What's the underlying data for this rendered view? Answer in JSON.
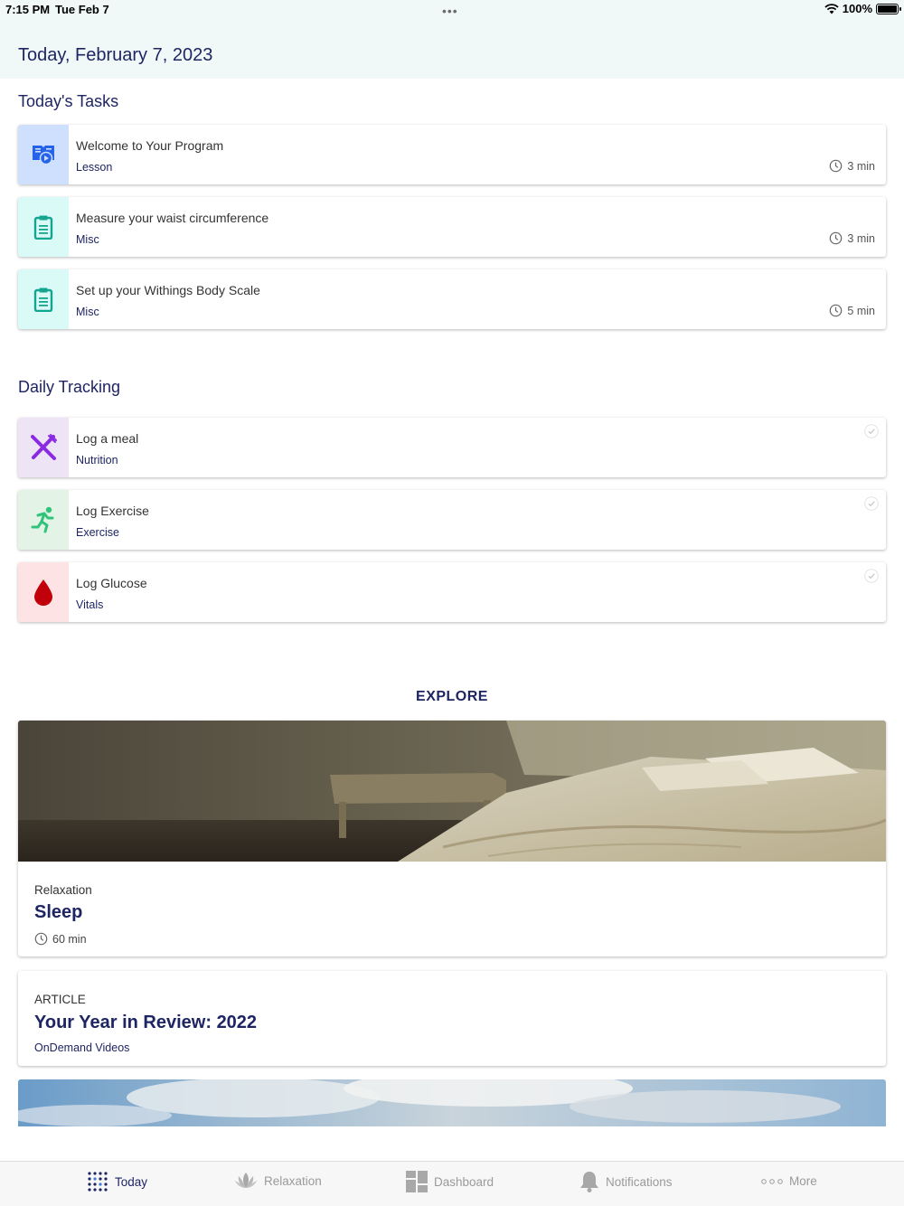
{
  "status_bar": {
    "time": "7:15 PM",
    "date": "Tue Feb 7",
    "dots": "•••",
    "battery": "100%",
    "battery_level": 1.0,
    "icons": [
      "wifi-icon",
      "battery-icon"
    ]
  },
  "header": {
    "date": "Today, February 7, 2023"
  },
  "tasks": {
    "title": "Today's Tasks",
    "items": [
      {
        "title": "Welcome to Your Program",
        "type": "Lesson",
        "duration": "3 min",
        "icon": "lesson-icon",
        "tile_color": "#cfe0ff",
        "icon_color": "#2563eb"
      },
      {
        "title": "Measure your waist circumference",
        "type": "Misc",
        "duration": "3 min",
        "icon": "clipboard-icon",
        "tile_color": "#d9faf6",
        "icon_color": "#13a58f"
      },
      {
        "title": "Set up your Withings Body Scale",
        "type": "Misc",
        "duration": "5 min",
        "icon": "clipboard-icon",
        "tile_color": "#d9faf6",
        "icon_color": "#13a58f"
      }
    ]
  },
  "tracking": {
    "title": "Daily Tracking",
    "items": [
      {
        "title": "Log a meal",
        "type": "Nutrition",
        "icon": "fork-knife-icon",
        "tile_color": "#ede4f5",
        "icon_color": "#8a2be2"
      },
      {
        "title": "Log Exercise",
        "type": "Exercise",
        "icon": "running-icon",
        "tile_color": "#e3f3e6",
        "icon_color": "#2fc47a"
      },
      {
        "title": "Log Glucose",
        "type": "Vitals",
        "icon": "blood-drop-icon",
        "tile_color": "#fde3e3",
        "icon_color": "#c0000a"
      }
    ]
  },
  "explore": {
    "title": "EXPLORE",
    "feature": {
      "category": "Relaxation",
      "name": "Sleep",
      "duration": "60 min"
    },
    "article": {
      "kind": "ARTICLE",
      "name": "Your Year in Review: 2022",
      "source": "OnDemand Videos"
    }
  },
  "tabbar": {
    "tabs": [
      {
        "label": "Today",
        "icon": "today-dots-icon",
        "active": true
      },
      {
        "label": "Relaxation",
        "icon": "lotus-icon",
        "active": false
      },
      {
        "label": "Dashboard",
        "icon": "dashboard-grid-icon",
        "active": false
      },
      {
        "label": "Notifications",
        "icon": "bell-icon",
        "active": false
      },
      {
        "label": "More",
        "icon": "more-dots-icon",
        "active": false
      }
    ]
  }
}
